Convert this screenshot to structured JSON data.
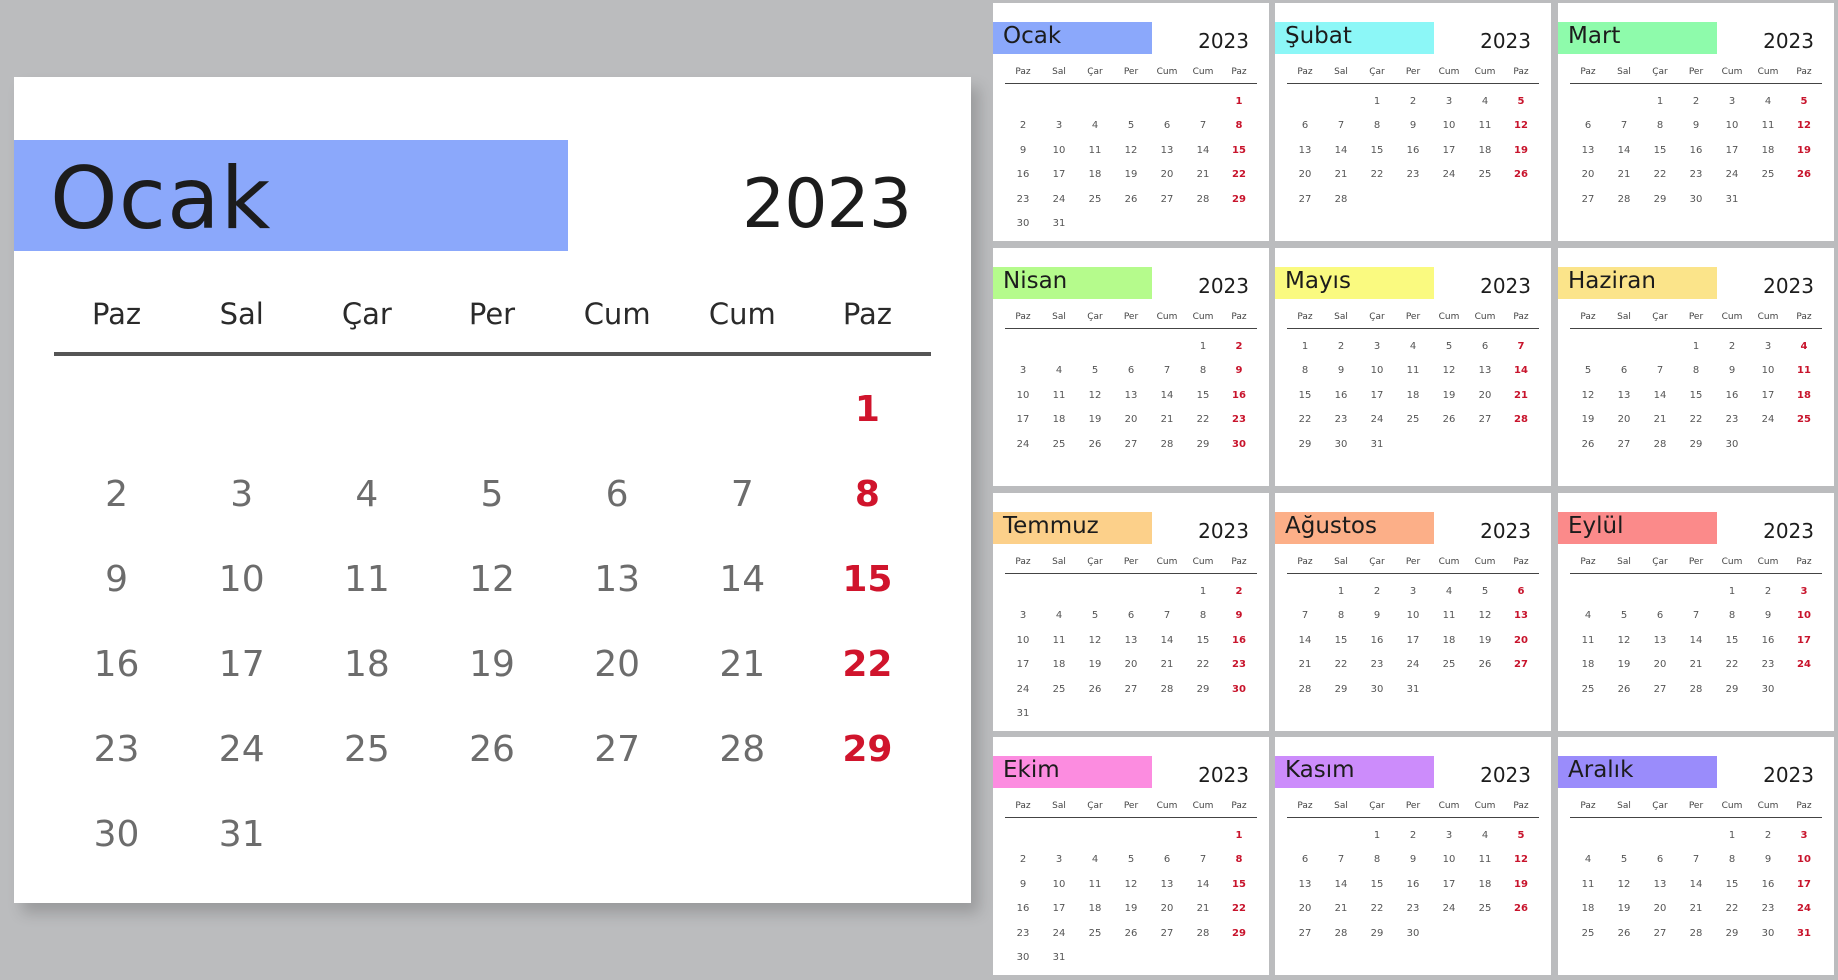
{
  "year": "2023",
  "weekdays": [
    "Paz",
    "Sal",
    "Çar",
    "Per",
    "Cum",
    "Cum",
    "Paz"
  ],
  "colors": {
    "background": "#bbbcbe",
    "card": "#ffffff",
    "sunday": "#d0142c",
    "day": "#6c6c6c"
  },
  "featured": {
    "name": "Ocak",
    "year": "2023",
    "color": "#8ba8fb",
    "offset": 6,
    "days": 31
  },
  "months": [
    {
      "name": "Ocak",
      "year": "2023",
      "color": "#8ba8fb",
      "offset": 6,
      "days": 31
    },
    {
      "name": "Şubat",
      "year": "2023",
      "color": "#8cf7f7",
      "offset": 2,
      "days": 28
    },
    {
      "name": "Mart",
      "year": "2023",
      "color": "#8efbab",
      "offset": 2,
      "days": 31
    },
    {
      "name": "Nisan",
      "year": "2023",
      "color": "#b5fb8c",
      "offset": 5,
      "days": 30
    },
    {
      "name": "Mayıs",
      "year": "2023",
      "color": "#fafa80",
      "offset": 0,
      "days": 31
    },
    {
      "name": "Haziran",
      "year": "2023",
      "color": "#fbe48a",
      "offset": 3,
      "days": 30
    },
    {
      "name": "Temmuz",
      "year": "2023",
      "color": "#fcd08a",
      "offset": 5,
      "days": 31
    },
    {
      "name": "Ağustos",
      "year": "2023",
      "color": "#fcaf88",
      "offset": 1,
      "days": 31
    },
    {
      "name": "Eylül",
      "year": "2023",
      "color": "#fb8a8a",
      "offset": 4,
      "days": 30
    },
    {
      "name": "Ekim",
      "year": "2023",
      "color": "#fc8ce0",
      "offset": 6,
      "days": 31
    },
    {
      "name": "Kasım",
      "year": "2023",
      "color": "#cc8cfb",
      "offset": 2,
      "days": 30
    },
    {
      "name": "Aralık",
      "year": "2023",
      "color": "#9a8cfb",
      "offset": 4,
      "days": 31
    }
  ]
}
